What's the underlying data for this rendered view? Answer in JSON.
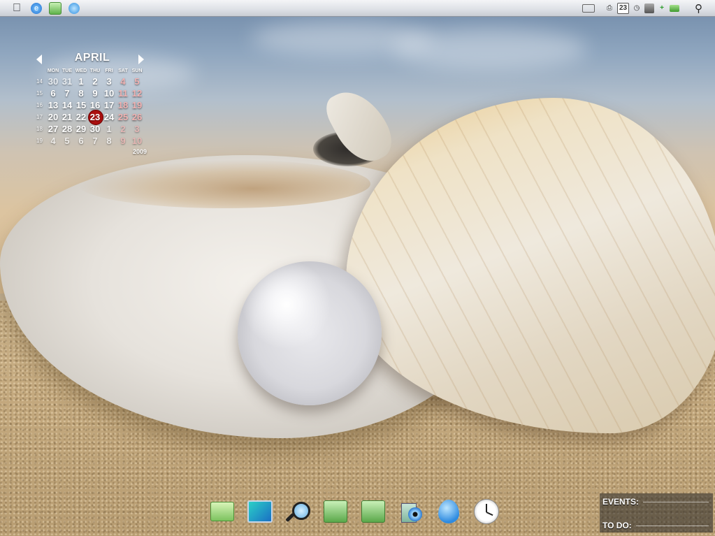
{
  "menubar": {
    "apple_icon": "apple-logo-icon",
    "left_icons": [
      "internet-explorer-icon",
      "green-folder-icon",
      "blue-globe-icon"
    ],
    "tray": {
      "icons": [
        "keyboard-icon",
        "printer-icon",
        "calendar-icon",
        "clock-icon",
        "network-icon",
        "add-icon",
        "mail-icon",
        "search-icon"
      ],
      "date_day": "23"
    }
  },
  "calendar": {
    "month": "APRIL",
    "year": "2009",
    "weekdays": [
      "MON",
      "TUE",
      "WED",
      "THU",
      "FRI",
      "SAT",
      "SUN"
    ],
    "weeks": [
      {
        "week": "14",
        "days": [
          "30",
          "31",
          "1",
          "2",
          "3",
          "4",
          "5"
        ]
      },
      {
        "week": "15",
        "days": [
          "6",
          "7",
          "8",
          "9",
          "10",
          "11",
          "12"
        ]
      },
      {
        "week": "16",
        "days": [
          "13",
          "14",
          "15",
          "16",
          "17",
          "18",
          "19"
        ]
      },
      {
        "week": "17",
        "days": [
          "20",
          "21",
          "22",
          "23",
          "24",
          "25",
          "26"
        ]
      },
      {
        "week": "18",
        "days": [
          "27",
          "28",
          "29",
          "30",
          "1",
          "2",
          "3"
        ]
      },
      {
        "week": "19",
        "days": [
          "4",
          "5",
          "6",
          "7",
          "8",
          "9",
          "10"
        ]
      }
    ],
    "today": "23",
    "today_color": "#c21a1a",
    "weekend_color": "#f1b2b2"
  },
  "dock": {
    "items": [
      "folder-icon",
      "monitor-icon",
      "magnifier-icon",
      "green-app-icon",
      "green-app-icon",
      "media-player-icon",
      "water-drop-icon",
      "clock-icon"
    ]
  },
  "notes_widget": {
    "events_label": "EVENTS:",
    "todo_label": "TO DO:"
  }
}
